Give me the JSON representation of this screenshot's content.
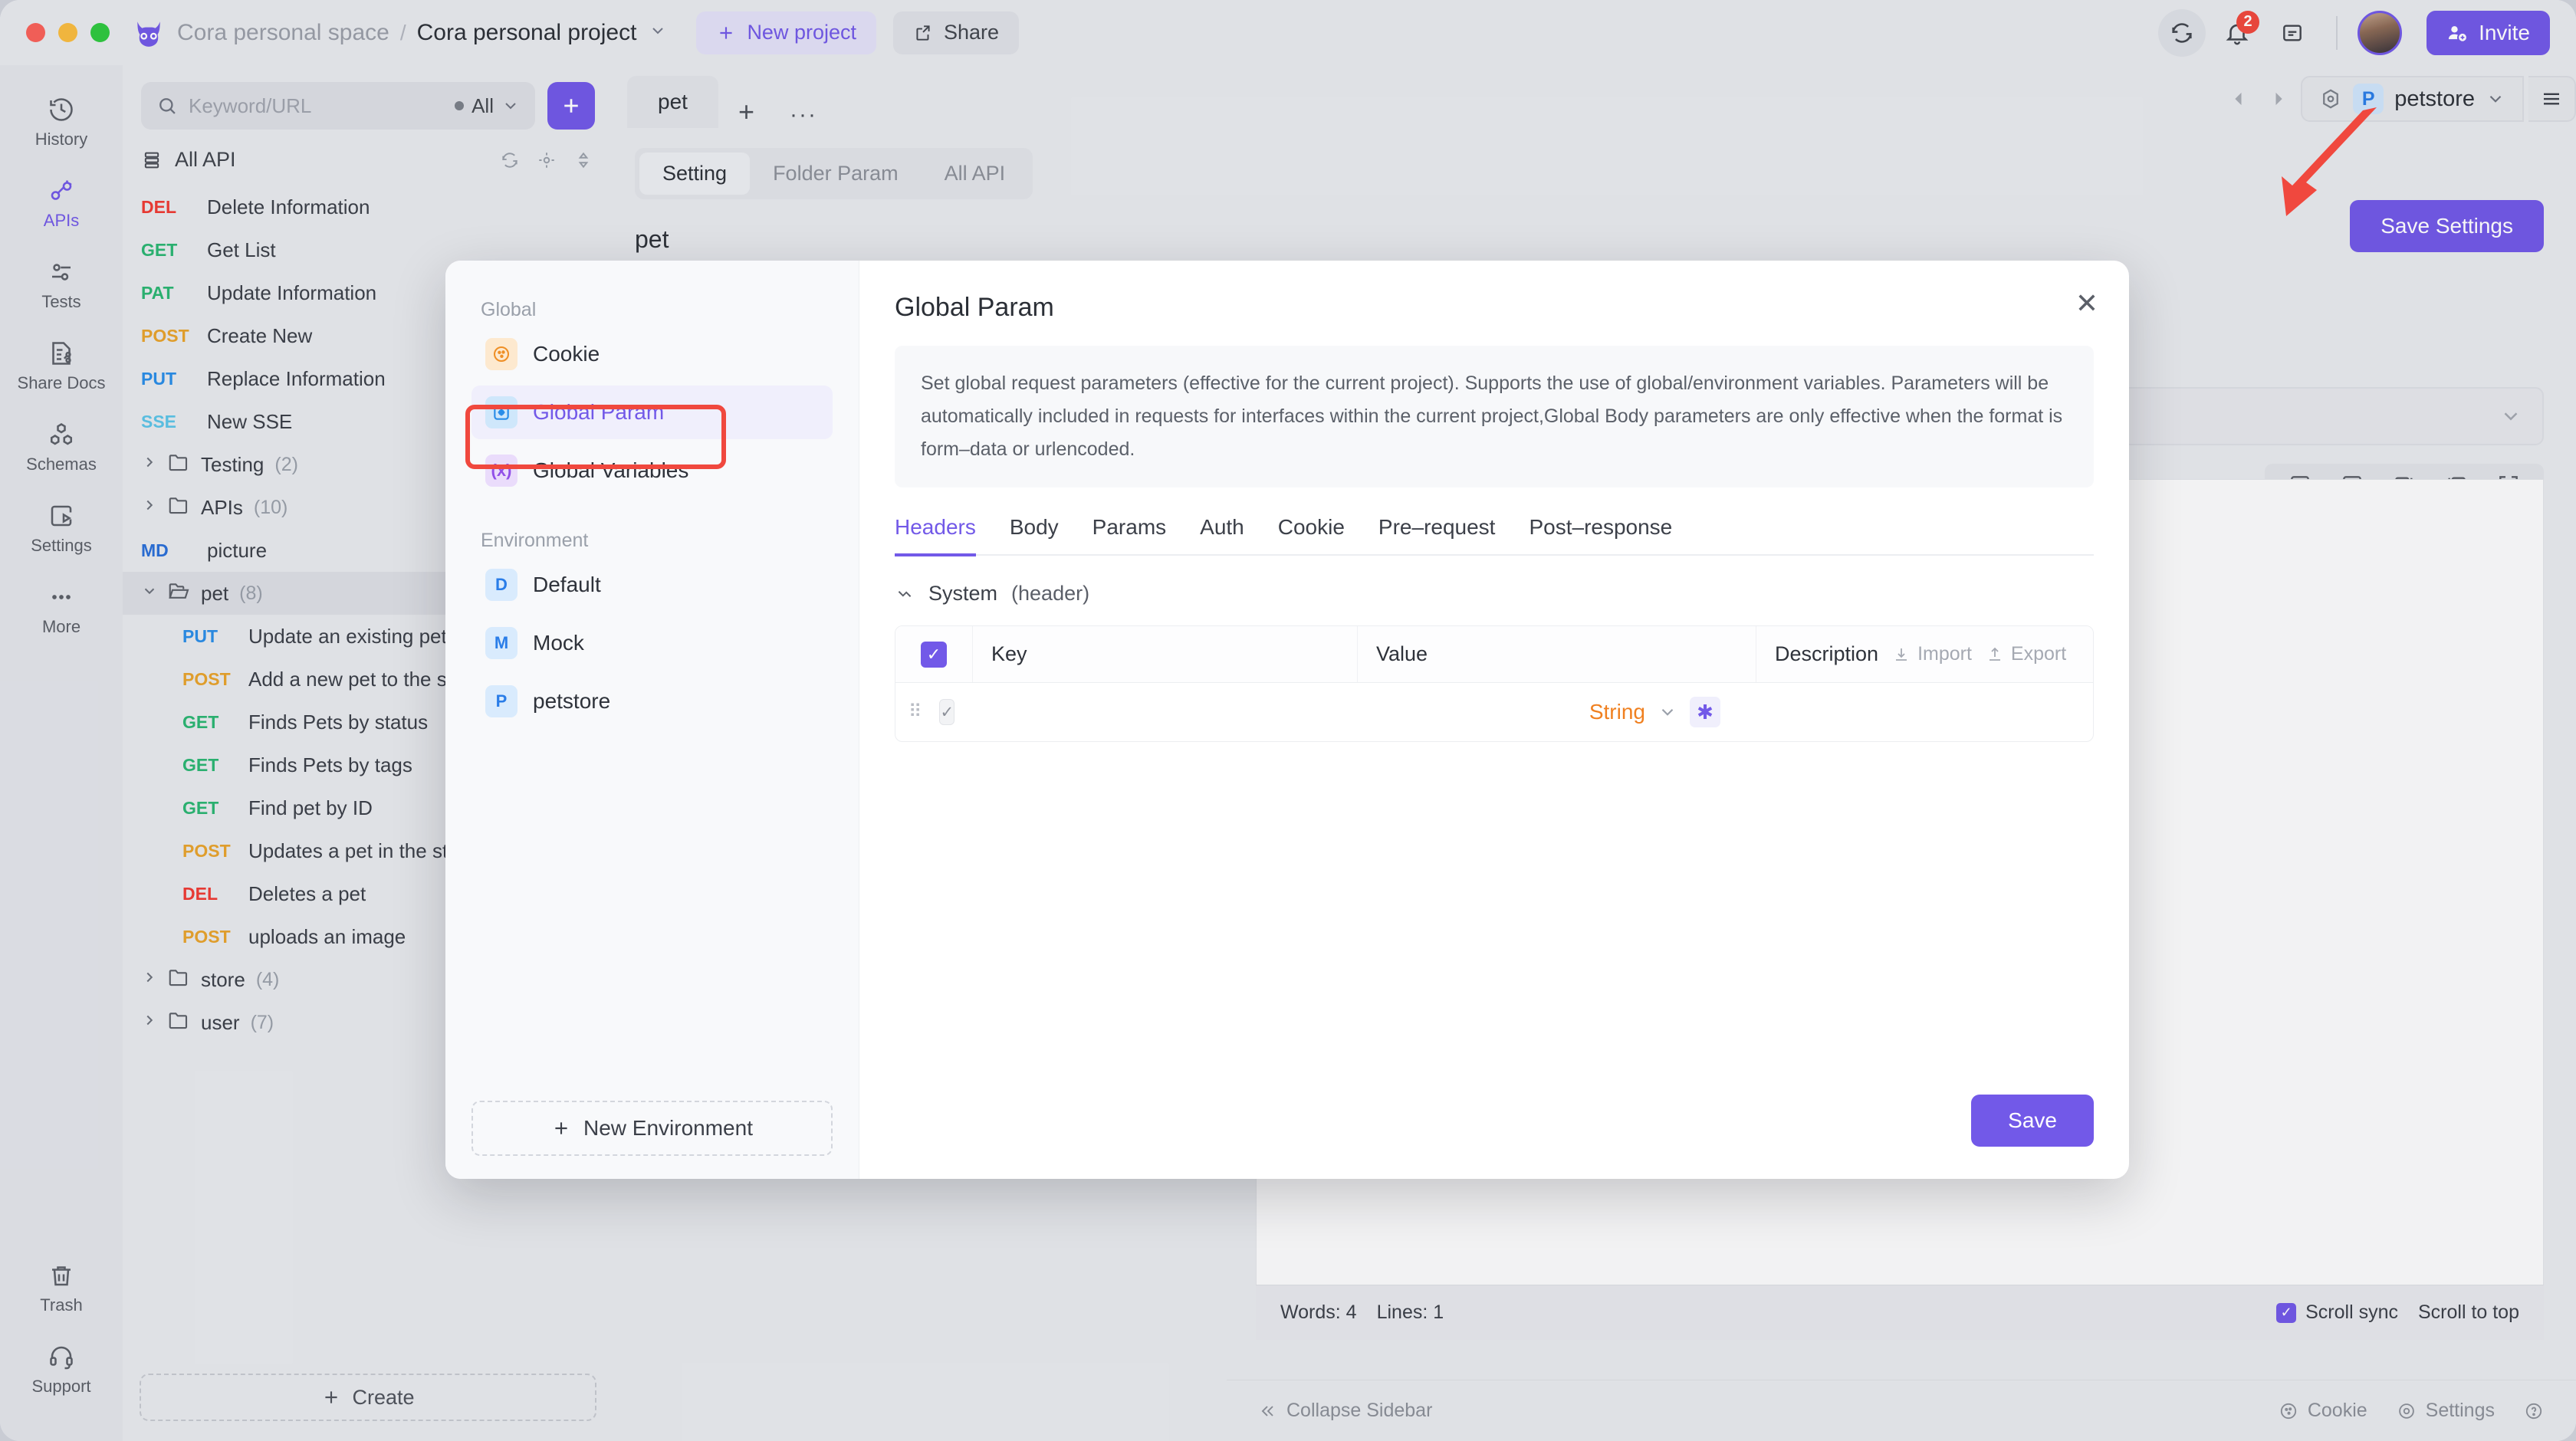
{
  "titlebar": {
    "space": "Cora personal space",
    "separator": "/",
    "project": "Cora personal project",
    "new_project": "New project",
    "share": "Share",
    "notification_count": "2",
    "invite": "Invite",
    "icons": {
      "owl": "owl-logo",
      "sync": "sync-icon",
      "bell": "bell-icon",
      "panel": "panel-icon",
      "invite": "add-user-icon"
    }
  },
  "rail": {
    "items": [
      {
        "label": "History",
        "icon": "history-icon",
        "active": false
      },
      {
        "label": "APIs",
        "icon": "api-link-icon",
        "active": true
      },
      {
        "label": "Tests",
        "icon": "sliders-icon",
        "active": false
      },
      {
        "label": "Share Docs",
        "icon": "share-docs-icon",
        "active": false
      },
      {
        "label": "Schemas",
        "icon": "schemas-icon",
        "active": false
      },
      {
        "label": "Settings",
        "icon": "settings-icon",
        "active": false
      },
      {
        "label": "More",
        "icon": "more-dots-icon",
        "active": false
      }
    ],
    "bottom": [
      {
        "label": "Trash",
        "icon": "trash-icon"
      },
      {
        "label": "Support",
        "icon": "headset-icon"
      }
    ]
  },
  "apilist": {
    "search_placeholder": "Keyword/URL",
    "filter_label": "All",
    "add_button": "+",
    "all_api_label": "All API",
    "create_label": "Create",
    "tree": [
      {
        "type": "api",
        "method": "DEL",
        "label": "Delete Information",
        "depth": 0
      },
      {
        "type": "api",
        "method": "GET",
        "label": "Get List",
        "depth": 0
      },
      {
        "type": "api",
        "method": "PAT",
        "label": "Update Information",
        "depth": 0
      },
      {
        "type": "api",
        "method": "POST",
        "label": "Create New",
        "depth": 0
      },
      {
        "type": "api",
        "method": "PUT",
        "label": "Replace Information",
        "depth": 0
      },
      {
        "type": "api",
        "method": "SSE",
        "label": "New SSE",
        "depth": 0
      },
      {
        "type": "folder",
        "label": "Testing",
        "count": "(2)",
        "expanded": false,
        "depth": 0
      },
      {
        "type": "folder",
        "label": "APIs",
        "count": "(10)",
        "expanded": false,
        "depth": 0
      },
      {
        "type": "api",
        "method": "MD",
        "label": "picture",
        "depth": 0
      },
      {
        "type": "folder",
        "label": "pet",
        "count": "(8)",
        "expanded": true,
        "selected": true,
        "depth": 0
      },
      {
        "type": "api",
        "method": "PUT",
        "label": "Update an existing pet",
        "depth": 1
      },
      {
        "type": "api",
        "method": "POST",
        "label": "Add a new pet to the store",
        "depth": 1
      },
      {
        "type": "api",
        "method": "GET",
        "label": "Finds Pets by status",
        "depth": 1
      },
      {
        "type": "api",
        "method": "GET",
        "label": "Finds Pets by tags",
        "depth": 1
      },
      {
        "type": "api",
        "method": "GET",
        "label": "Find pet by ID",
        "depth": 1
      },
      {
        "type": "api",
        "method": "POST",
        "label": "Updates a pet in the store",
        "depth": 1
      },
      {
        "type": "api",
        "method": "DEL",
        "label": "Deletes a pet",
        "depth": 1
      },
      {
        "type": "api",
        "method": "POST",
        "label": "uploads an image",
        "depth": 1
      },
      {
        "type": "folder",
        "label": "store",
        "count": "(4)",
        "expanded": false,
        "depth": 0
      },
      {
        "type": "folder",
        "label": "user",
        "count": "(7)",
        "expanded": false,
        "depth": 0
      }
    ]
  },
  "main": {
    "tab_label": "pet",
    "subtabs": [
      {
        "label": "Setting",
        "active": true
      },
      {
        "label": "Folder Param",
        "active": false
      },
      {
        "label": "All API",
        "active": false
      }
    ],
    "page_title": "pet",
    "save_settings": "Save Settings",
    "env": {
      "badge": "P",
      "name": "petstore"
    },
    "status": {
      "words": "Words: 4",
      "lines": "Lines: 1",
      "scroll_sync": "Scroll sync",
      "scroll_top": "Scroll to top"
    },
    "footer": {
      "collapse": "Collapse Sidebar",
      "cookie": "Cookie",
      "settings": "Settings"
    }
  },
  "modal": {
    "title": "Global Param",
    "close": "✕",
    "notice": "Set global request parameters (effective for the current project). Supports the use of global/environment variables. Parameters will be automatically included in requests for interfaces within the current project,Global Body parameters are only effective when the format is form–data or urlencoded.",
    "nav": {
      "global_label": "Global",
      "environment_label": "Environment",
      "global_items": [
        {
          "label": "Cookie",
          "icon": "cookie-icon",
          "badge": "",
          "active": false
        },
        {
          "label": "Global Param",
          "icon": "global-param-icon",
          "badge": "",
          "active": true
        },
        {
          "label": "Global Variables",
          "icon": "global-variables-icon",
          "badge": "",
          "active": false
        }
      ],
      "env_items": [
        {
          "label": "Default",
          "badge": "D"
        },
        {
          "label": "Mock",
          "badge": "M"
        },
        {
          "label": "petstore",
          "badge": "P"
        }
      ],
      "new_environment": "New Environment"
    },
    "tabs": [
      {
        "label": "Headers",
        "active": true
      },
      {
        "label": "Body",
        "active": false
      },
      {
        "label": "Params",
        "active": false
      },
      {
        "label": "Auth",
        "active": false
      },
      {
        "label": "Cookie",
        "active": false
      },
      {
        "label": "Pre–request",
        "active": false
      },
      {
        "label": "Post–response",
        "active": false
      }
    ],
    "system_label": "System",
    "system_suffix": "(header)",
    "table": {
      "headers": {
        "key": "Key",
        "value": "Value",
        "description": "Description"
      },
      "import": "Import",
      "export": "Export",
      "rows": [
        {
          "key": "",
          "value": "",
          "description": "",
          "type": "String",
          "enabled": true
        }
      ]
    },
    "save": "Save"
  },
  "colors": {
    "accent": "#7259e8",
    "annotation": "#f0483e",
    "type_orange": "#f08020"
  }
}
